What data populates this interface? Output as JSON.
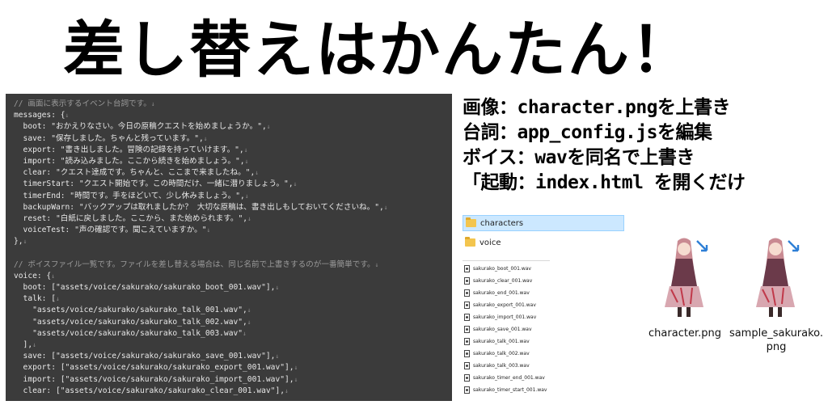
{
  "headline": "差し替えはかんたん！",
  "code_lines": [
    {
      "text": "// 画面に表示するイベント台詞です。",
      "comment": true
    },
    {
      "text": "messages: {",
      "comment": false
    },
    {
      "text": "  boot: \"おかえりなさい。今日の原稿クエストを始めましょうか。\",",
      "comment": false
    },
    {
      "text": "  save: \"保存しました。ちゃんと残っています。\",",
      "comment": false
    },
    {
      "text": "  export: \"書き出しました。冒険の記録を持っていけます。\",",
      "comment": false
    },
    {
      "text": "  import: \"読み込みました。ここから続きを始めましょう。\",",
      "comment": false
    },
    {
      "text": "  clear: \"クエスト達成です。ちゃんと、ここまで来ましたね。\",",
      "comment": false
    },
    {
      "text": "  timerStart: \"クエスト開始です。この時間だけ、一緒に潜りましょう。\",",
      "comment": false
    },
    {
      "text": "  timerEnd: \"時間です。手をほどいて、少し休みましょう。\",",
      "comment": false
    },
    {
      "text": "  backupWarn: \"バックアップは取れましたか？ 大切な原稿は、書き出しもしておいてくださいね。\",",
      "comment": false
    },
    {
      "text": "  reset: \"白紙に戻しました。ここから、また始められます。\",",
      "comment": false
    },
    {
      "text": "  voiceTest: \"声の確認です。聞こえていますか。\"",
      "comment": false
    },
    {
      "text": "},",
      "comment": false
    },
    {
      "text": "",
      "comment": false
    },
    {
      "text": "// ボイスファイル一覧です。ファイルを差し替える場合は、同じ名前で上書きするのが一番簡単です。",
      "comment": true
    },
    {
      "text": "voice: {",
      "comment": false
    },
    {
      "text": "  boot: [\"assets/voice/sakurako/sakurako_boot_001.wav\"],",
      "comment": false
    },
    {
      "text": "  talk: [",
      "comment": false
    },
    {
      "text": "    \"assets/voice/sakurako/sakurako_talk_001.wav\",",
      "comment": false
    },
    {
      "text": "    \"assets/voice/sakurako/sakurako_talk_002.wav\",",
      "comment": false
    },
    {
      "text": "    \"assets/voice/sakurako/sakurako_talk_003.wav\"",
      "comment": false
    },
    {
      "text": "  ],",
      "comment": false
    },
    {
      "text": "  save: [\"assets/voice/sakurako/sakurako_save_001.wav\"],",
      "comment": false
    },
    {
      "text": "  export: [\"assets/voice/sakurako/sakurako_export_001.wav\"],",
      "comment": false
    },
    {
      "text": "  import: [\"assets/voice/sakurako/sakurako_import_001.wav\"],",
      "comment": false
    },
    {
      "text": "  clear: [\"assets/voice/sakurako/sakurako_clear_001.wav\"],",
      "comment": false
    }
  ],
  "eol_mark": "↓",
  "notes": [
    "画像：character.pngを上書き",
    "台詞：app_config.jsを編集",
    "ボイス：wavを同名で上書き",
    "「起動：index.html を開くだけ"
  ],
  "folders": [
    "characters",
    "voice"
  ],
  "files": [
    "sakurako_boot_001.wav",
    "sakurako_clear_001.wav",
    "sakurako_end_001.wav",
    "sakurako_export_001.wav",
    "sakurako_import_001.wav",
    "sakurako_save_001.wav",
    "sakurako_talk_001.wav",
    "sakurako_talk_002.wav",
    "sakurako_talk_003.wav",
    "sakurako_timer_end_001.wav",
    "sakurako_timer_start_001.wav"
  ],
  "images": [
    {
      "caption": "character.png"
    },
    {
      "caption": "sample_sakurako.\npng"
    }
  ],
  "colors": {
    "editor_bg": "#3b3b3b",
    "comment": "#9a9a9a",
    "selected_folder": "#cce8ff",
    "folder": "#f3c54e"
  }
}
